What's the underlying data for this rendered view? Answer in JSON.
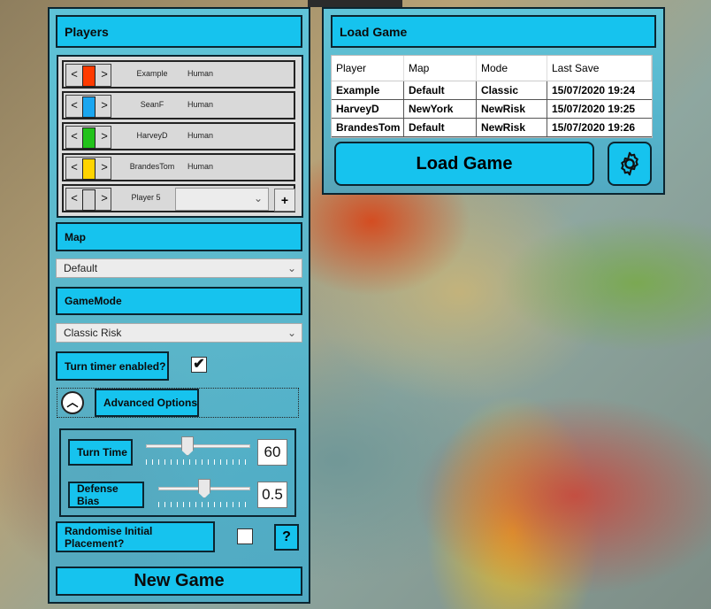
{
  "players_panel": {
    "title": "Players",
    "players": [
      {
        "name": "Example",
        "type": "Human",
        "color": "#ff3a00"
      },
      {
        "name": "SeanF",
        "type": "Human",
        "color": "#1aa6f0"
      },
      {
        "name": "HarveyD",
        "type": "Human",
        "color": "#22c21a"
      },
      {
        "name": "BrandesTom",
        "type": "Human",
        "color": "#ffd400"
      }
    ],
    "new_player": {
      "name": "Player 5",
      "color": "#d4d4d4",
      "add_label": "+"
    },
    "arrow_left": "<",
    "arrow_right": ">"
  },
  "map": {
    "title": "Map",
    "selected": "Default"
  },
  "gamemode": {
    "title": "GameMode",
    "selected": "Classic Risk"
  },
  "turn_timer": {
    "label": "Turn timer enabled?",
    "checked": true,
    "check_mark": "✔"
  },
  "advanced": {
    "label": "Advanced Options",
    "toggle_glyph": "︿",
    "turn_time": {
      "label": "Turn Time",
      "value": "60",
      "level": 0.4
    },
    "defense_bias": {
      "label": "Defense Bias",
      "value": "0.5",
      "level": 0.5
    }
  },
  "randomise": {
    "label": "Randomise Initial Placement?",
    "checked": false,
    "help_label": "?"
  },
  "new_game_label": "New Game",
  "load_panel": {
    "title": "Load Game",
    "columns": [
      "Player",
      "Map",
      "Mode",
      "Last Save"
    ],
    "rows": [
      [
        "Example",
        "Default",
        "Classic",
        "15/07/2020 19:24"
      ],
      [
        "HarveyD",
        "NewYork",
        "NewRisk",
        "15/07/2020 19:25"
      ],
      [
        "BrandesTom",
        "Default",
        "NewRisk",
        "15/07/2020 19:26"
      ]
    ],
    "button_label": "Load Game",
    "settings_icon": "gear-icon"
  },
  "chevron": "⌄"
}
